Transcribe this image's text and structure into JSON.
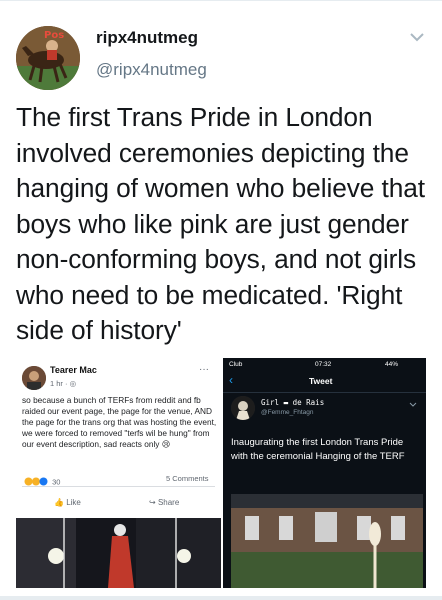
{
  "tweet": {
    "display_name": "ripx4nutmeg",
    "handle": "@ripx4nutmeg",
    "text": "The first Trans Pride in London involved ceremonies depicting the hanging of women who believe that boys who like pink are just gender non-conforming boys, and not girls who need to be medicated. 'Right side of history'",
    "menu_icon": "chevron-down-icon"
  },
  "media": {
    "left": {
      "author": "Tearer Mac",
      "meta": "1 hr · ◎",
      "more": "···",
      "post_text": "so because a bunch of TERFs from reddit and fb raided our event page, the page for the venue, AND the page for the trans org that was hosting the event, we were forced to removed \"terfs wil be hung\" from our event description, sad reacts only 😢",
      "reaction_count": "30",
      "comments": "5 Comments",
      "like_label": "Like",
      "share_label": "Share"
    },
    "right": {
      "status_carrier": "Club",
      "status_time": "07:32",
      "status_battery": "44%",
      "header_title": "Tweet",
      "author_name": "Girl ▬ de Rais",
      "author_handle": "@Femme_Fhtagn",
      "tweet_text": "Inaugurating the first London Trans Pride with the ceremonial Hanging of the TERF"
    }
  },
  "colors": {
    "text": "#14171a",
    "secondary": "#657786",
    "twitter_blue": "#1da1f2",
    "dark_bg": "#0b1016"
  }
}
